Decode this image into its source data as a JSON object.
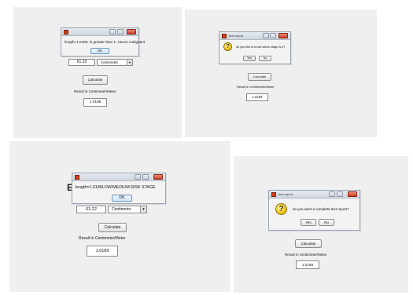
{
  "screen1": {
    "dialog": {
      "message": "length=1.0189, is greater than 1. Hence malignant",
      "ok_label": "OK"
    },
    "value_field": "61.22",
    "unit_select": "Centimeter",
    "calculate_label": "Calculate",
    "result_label": "Result in Centimeter/Meter",
    "result_value": "1.0189"
  },
  "screen2": {
    "dialog": {
      "title": "text report",
      "message": "do you like to know which stage is it?",
      "yes_label": "Yes",
      "no_label": "No"
    },
    "calculate_label": "Calculate",
    "result_label": "Result in Centimeter/Meter",
    "result_value": "1.0189"
  },
  "screen3": {
    "heading_fragment": "E",
    "dialog": {
      "message": "length=1.0189LOW/MEDIUM RISK STAGE",
      "ok_label": "OK"
    },
    "value_field": "61.22",
    "unit_select": "Centimeter",
    "calculate_label": "Calculate",
    "result_label": "Result in Centimeter/Meter",
    "result_value": "1.0189"
  },
  "screen4": {
    "dialog": {
      "title": "text report",
      "message": "do you want a complete text report?",
      "yes_label": "Yes",
      "no_label": "No"
    },
    "calculate_label": "Calculate",
    "result_label": "Result in Centimeter/Meter",
    "result_value": "1.0189"
  },
  "icons": {
    "dialog_question": "question-icon",
    "app": "matlab-app-icon",
    "select_arrow": "chevron-down-icon"
  }
}
